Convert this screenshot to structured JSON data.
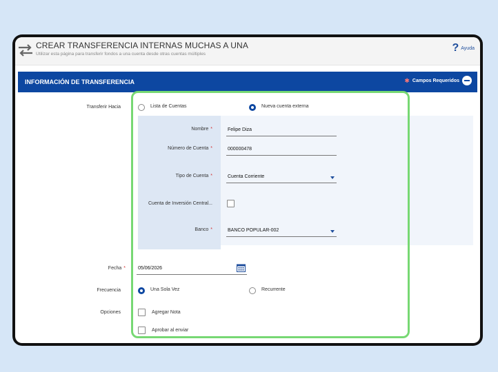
{
  "header": {
    "title": "CREAR TRANSFERENCIA INTERNAS MUCHAS A UNA",
    "subtitle": "Utilizar esta página para transferir fondos a una cuenta desde otras cuentas múltiples",
    "help_label": "Ayuda"
  },
  "section": {
    "title": "INFORMACIÓN DE TRANSFERENCIA",
    "required_label": "Campos Requeridos"
  },
  "transfer_to": {
    "label": "Transferir Hacia",
    "option_list": "Lista de Cuentas",
    "option_external": "Nueva cuenta externa",
    "selected": "Nueva cuenta externa"
  },
  "external": {
    "name_label": "Nombre",
    "name_value": "Felipe Diza",
    "account_number_label": "Número de Cuenta",
    "account_number_value": "000000478",
    "account_type_label": "Tipo de Cuenta",
    "account_type_value": "Cuenta Corriente",
    "central_investment_label": "Cuenta de Inversión Central...",
    "bank_label": "Banco",
    "bank_value": "BANCO POPULAR-002"
  },
  "date": {
    "label": "Fecha",
    "value": "05/06/2026"
  },
  "frequency": {
    "label": "Frecuencia",
    "option_once": "Una Sola Vez",
    "option_recurring": "Recurrente",
    "selected": "Una Sola Vez"
  },
  "options": {
    "label": "Opciones",
    "add_note": "Agregar Nota",
    "approve_on_send": "Aprobar al enviar"
  },
  "colors": {
    "accent": "#0d47a1",
    "highlight": "#77d873",
    "required": "#d32f2f"
  }
}
